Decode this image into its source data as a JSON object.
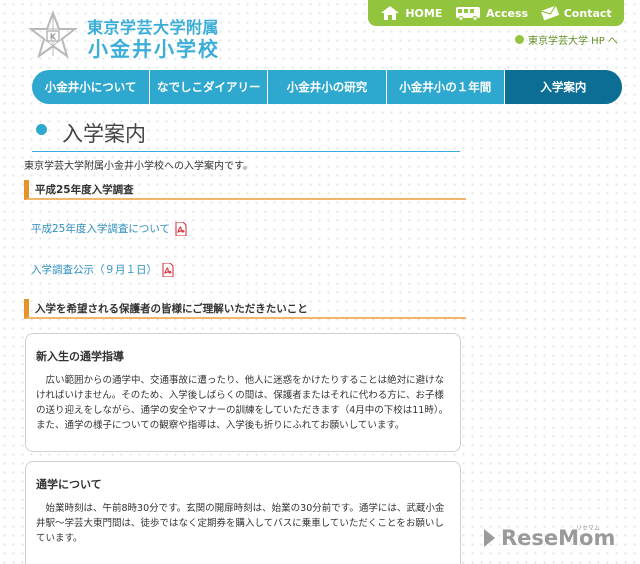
{
  "header": {
    "school_name_line1": "東京学芸大学附属",
    "school_name_line2": "小金井小学校",
    "topbar": [
      {
        "label": "HOME",
        "icon": "home-icon"
      },
      {
        "label": "Access",
        "icon": "bus-icon"
      },
      {
        "label": "Contact",
        "icon": "envelope-icon"
      }
    ],
    "external_link": "東京学芸大学 HP へ"
  },
  "nav": {
    "items": [
      "小金井小について",
      "なでしこダイアリー",
      "小金井小の研究",
      "小金井小の１年間",
      "入学案内"
    ],
    "active_index": 4
  },
  "page": {
    "title": "入学案内",
    "intro": "東京学芸大学附属小金井小学校への入学案内です。"
  },
  "sections": [
    {
      "heading": "平成25年度入学調査",
      "links": [
        {
          "label": "平成25年度入学調査について",
          "icon": "pdf-icon"
        },
        {
          "label": "入学調査公示（９月１日）",
          "icon": "pdf-icon"
        }
      ]
    },
    {
      "heading": "入学を希望される保護者の皆様にご理解いただきたいこと",
      "boxes": [
        {
          "title": "新入生の通学指導",
          "body": "広い範囲からの通学中、交通事故に遭ったり、他人に迷惑をかけたりすることは絶対に避けなければいけません。そのため、入学後しばらくの間は、保護者またはそれに代わる方に、お子様の送り迎えをしながら、通学の安全やマナーの訓練をしていただきます（4月中の下校は11時）。また、通学の様子についての観察や指導は、入学後も折りにふれてお願いしています。"
        },
        {
          "title": "通学について",
          "body": "始業時刻は、午前8時30分です。玄関の開扉時刻は、始業の30分前です。通学には、武蔵小金井駅～学芸大東門間は、徒歩ではなく定期券を購入してバスに乗車していただくことをお願いしています。"
        }
      ]
    }
  ],
  "watermark": {
    "text": "ReseMom",
    "kana": "リセマム"
  },
  "colors": {
    "brand_blue": "#2fa8cf",
    "nav_active": "#0d6e95",
    "topbar_green": "#93c43d",
    "section_orange": "#e8922a",
    "pdf_red": "#d9232d"
  }
}
